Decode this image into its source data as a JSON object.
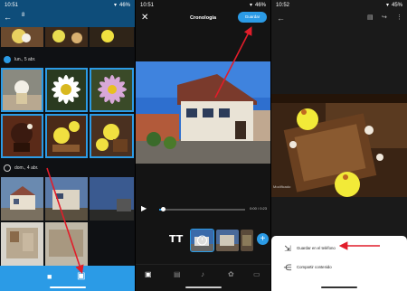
{
  "panel1": {
    "status": {
      "time": "10:51",
      "battery": "46%"
    },
    "selected_count": "8",
    "groups": [
      {
        "date": "lun., 5 abr."
      },
      {
        "date": "dom., 4 abr."
      }
    ],
    "bottom_nav": [
      "video-icon",
      "movie-create-icon"
    ]
  },
  "panel2": {
    "status": {
      "time": "10:51",
      "battery": "46%"
    },
    "title": "Cronología",
    "save_label": "Guardar",
    "time_display": "0:00 / 0:23",
    "text_tool": "TT",
    "add_label": "+"
  },
  "panel3": {
    "status": {
      "time": "10:52",
      "battery": "45%"
    },
    "watermark": "Modificado",
    "sheet": {
      "save_label": "Guardar en el teléfono",
      "share_label": "Compartir contenido"
    }
  },
  "colors": {
    "accent": "#2b9be6",
    "annotation": "#e11d2a"
  }
}
